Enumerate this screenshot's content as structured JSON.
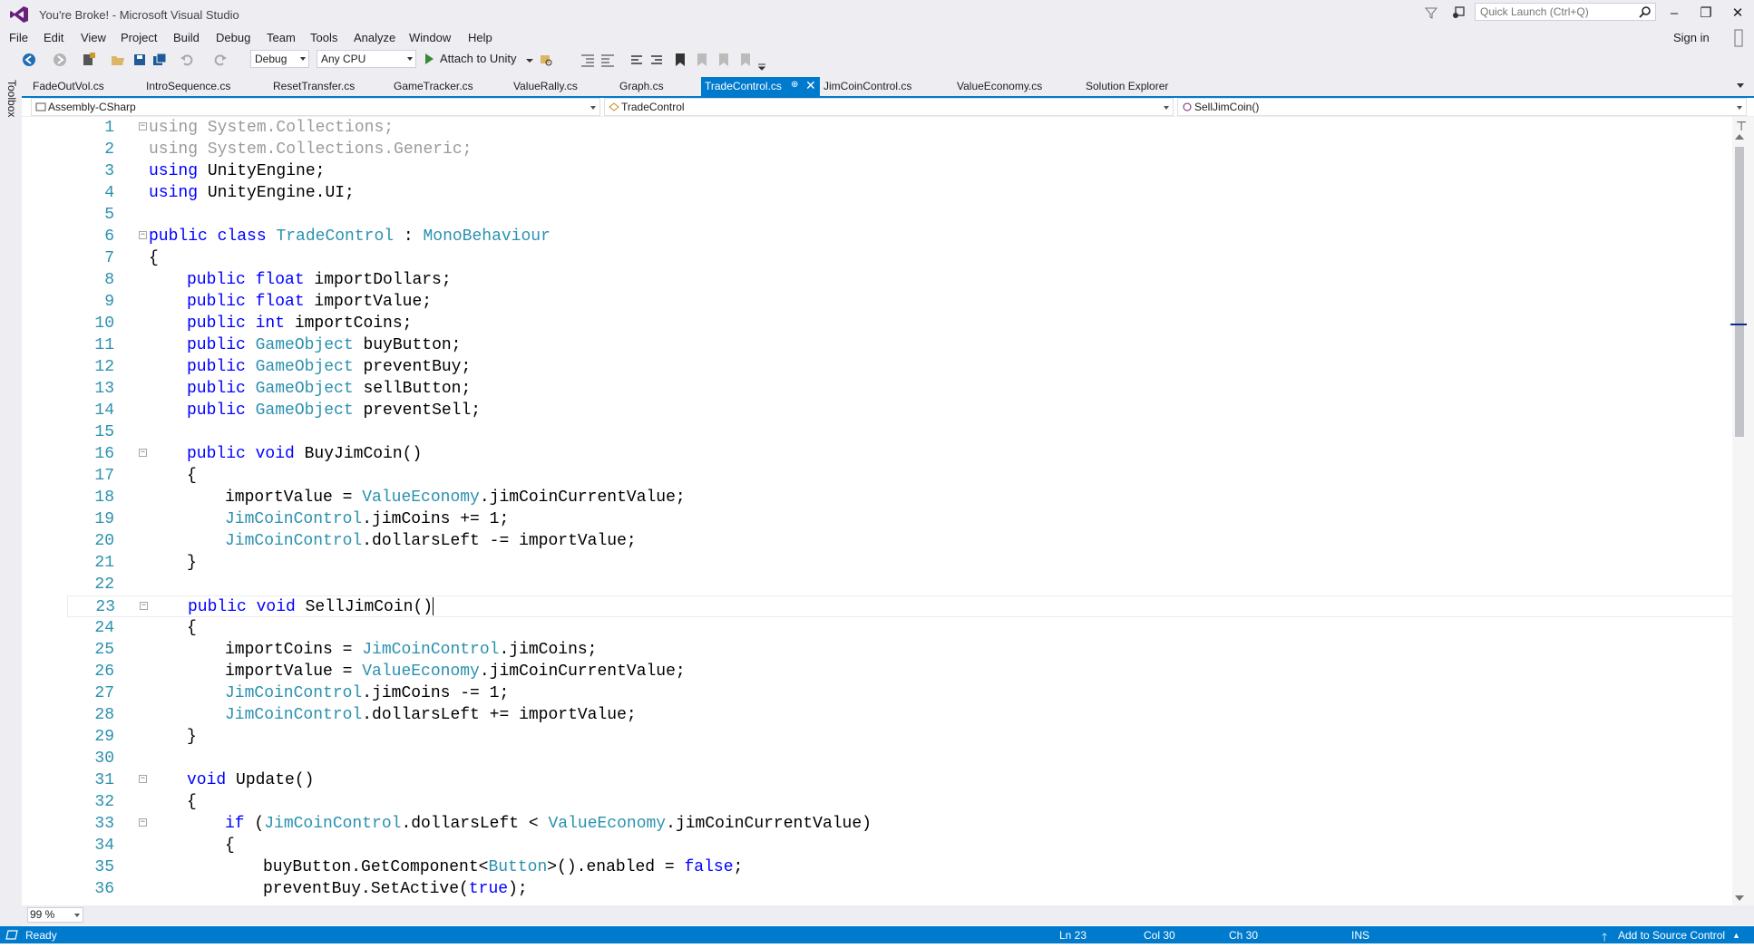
{
  "window": {
    "title": "You're Broke! - Microsoft Visual Studio",
    "quick_launch_placeholder": "Quick Launch (Ctrl+Q)",
    "sign_in": "Sign in"
  },
  "menu": [
    "File",
    "Edit",
    "View",
    "Project",
    "Build",
    "Debug",
    "Team",
    "Tools",
    "Analyze",
    "Window",
    "Help"
  ],
  "toolbar": {
    "configuration": "Debug",
    "platform": "Any CPU",
    "attach_label": "Attach to Unity"
  },
  "toolbox_label": "Toolbox",
  "tabs": [
    "FadeOutVol.cs",
    "IntroSequence.cs",
    "ResetTransfer.cs",
    "GameTracker.cs",
    "ValueRally.cs",
    "Graph.cs",
    "TradeControl.cs",
    "JimCoinControl.cs",
    "ValueEconomy.cs",
    "Solution Explorer"
  ],
  "active_tab": "TradeControl.cs",
  "navbar": {
    "project": "Assembly-CSharp",
    "class": "TradeControl",
    "member": "SellJimCoin()"
  },
  "line_numbers": [
    "1",
    "2",
    "3",
    "4",
    "5",
    "6",
    "7",
    "8",
    "9",
    "10",
    "11",
    "12",
    "13",
    "14",
    "15",
    "16",
    "17",
    "18",
    "19",
    "20",
    "21",
    "22",
    "23",
    "24",
    "25",
    "26",
    "27",
    "28",
    "29",
    "30",
    "31",
    "32",
    "33",
    "34",
    "35",
    "36"
  ],
  "code": {
    "l1": {
      "a": "using System.Collections;"
    },
    "l2": {
      "a": "using System.Collections.Generic;"
    },
    "l3": {
      "k": "using",
      "r": " UnityEngine;"
    },
    "l4": {
      "k": "using",
      "r": " UnityEngine.UI;"
    },
    "l6": {
      "k": "public class",
      "sp": " ",
      "t": "TradeControl",
      "c": " : ",
      "t2": "MonoBehaviour"
    },
    "l7": {
      "r": "{"
    },
    "l8": {
      "k": "public float",
      "r": " importDollars;"
    },
    "l9": {
      "k": "public float",
      "r": " importValue;"
    },
    "l10": {
      "k": "public int",
      "r": " importCoins;"
    },
    "l11": {
      "k": "public",
      "sp": " ",
      "t": "GameObject",
      "r": " buyButton;"
    },
    "l12": {
      "k": "public",
      "sp": " ",
      "t": "GameObject",
      "r": " preventBuy;"
    },
    "l13": {
      "k": "public",
      "sp": " ",
      "t": "GameObject",
      "r": " sellButton;"
    },
    "l14": {
      "k": "public",
      "sp": " ",
      "t": "GameObject",
      "r": " preventSell;"
    },
    "l16": {
      "k": "public void",
      "r": " BuyJimCoin()"
    },
    "l17": {
      "r": "{"
    },
    "l18": {
      "r": "importValue = ",
      "t": "ValueEconomy",
      "r2": ".jimCoinCurrentValue;"
    },
    "l19": {
      "t": "JimCoinControl",
      "r": ".jimCoins += 1;"
    },
    "l20": {
      "t": "JimCoinControl",
      "r": ".dollarsLeft -= importValue;"
    },
    "l21": {
      "r": "}"
    },
    "l23": {
      "k": "public void",
      "r": " SellJimCoin()"
    },
    "l24": {
      "r": "{"
    },
    "l25": {
      "r": "importCoins = ",
      "t": "JimCoinControl",
      "r2": ".jimCoins;"
    },
    "l26": {
      "r": "importValue = ",
      "t": "ValueEconomy",
      "r2": ".jimCoinCurrentValue;"
    },
    "l27": {
      "t": "JimCoinControl",
      "r": ".jimCoins -= 1;"
    },
    "l28": {
      "t": "JimCoinControl",
      "r": ".dollarsLeft += importValue;"
    },
    "l29": {
      "r": "}"
    },
    "l31": {
      "k": "void",
      "r": " Update()"
    },
    "l32": {
      "r": "{"
    },
    "l33": {
      "k": "if",
      "r": " (",
      "t": "JimCoinControl",
      "r2": ".dollarsLeft < ",
      "t2": "ValueEconomy",
      "r3": ".jimCoinCurrentValue)"
    },
    "l34": {
      "r": "{"
    },
    "l35": {
      "r": "buyButton.GetComponent<",
      "t": "Button",
      "r2": ">().enabled = ",
      "k": "false",
      "r3": ";"
    },
    "l36": {
      "r": "preventBuy.SetActive(",
      "k": "true",
      "r2": ");"
    }
  },
  "zoom": "99 %",
  "status": {
    "ready": "Ready",
    "line": "Ln 23",
    "col": "Col 30",
    "ch": "Ch 30",
    "mode": "INS",
    "source_control": "Add to Source Control"
  },
  "colors": {
    "accent": "#007acc",
    "keyword": "#0000ff",
    "type": "#2b91af",
    "chrome": "#eeeef2"
  }
}
